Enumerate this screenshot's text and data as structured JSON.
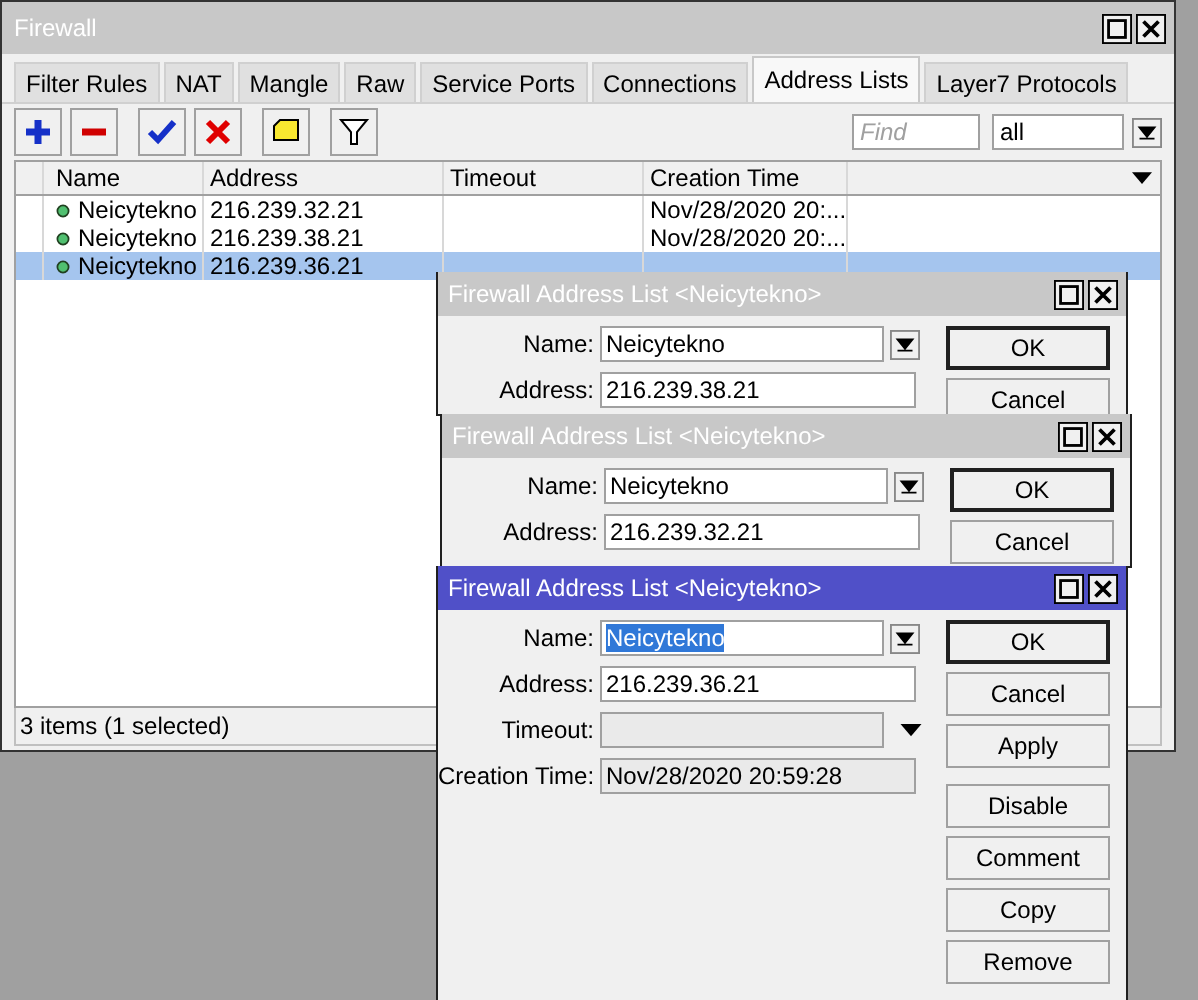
{
  "window": {
    "title": "Firewall"
  },
  "tabs": [
    {
      "label": "Filter Rules",
      "selected": false
    },
    {
      "label": "NAT",
      "selected": false
    },
    {
      "label": "Mangle",
      "selected": false
    },
    {
      "label": "Raw",
      "selected": false
    },
    {
      "label": "Service Ports",
      "selected": false
    },
    {
      "label": "Connections",
      "selected": false
    },
    {
      "label": "Address Lists",
      "selected": true
    },
    {
      "label": "Layer7 Protocols",
      "selected": false
    }
  ],
  "toolbar": {
    "find_placeholder": "Find",
    "filter_value": "all"
  },
  "table": {
    "columns": [
      "Name",
      "Address",
      "Timeout",
      "Creation Time"
    ],
    "rows": [
      {
        "name": "Neicytekno",
        "address": "216.239.32.21",
        "creation_time": "Nov/28/2020 20:...",
        "selected": false
      },
      {
        "name": "Neicytekno",
        "address": "216.239.38.21",
        "creation_time": "Nov/28/2020 20:...",
        "selected": false
      },
      {
        "name": "Neicytekno",
        "address": "216.239.36.21",
        "selected": true
      }
    ]
  },
  "status_bar": "3 items (1 selected)",
  "dialogs": [
    {
      "title": "Firewall Address List <Neicytekno>",
      "active": false,
      "name_selected": false,
      "fields": [
        {
          "label": "Name:",
          "value": "Neicytekno",
          "kind": "dropdown"
        },
        {
          "label": "Address:",
          "value": "216.239.38.21",
          "kind": "text"
        }
      ],
      "buttons": [
        [
          "OK",
          "Cancel"
        ]
      ]
    },
    {
      "title": "Firewall Address List <Neicytekno>",
      "active": false,
      "name_selected": false,
      "fields": [
        {
          "label": "Name:",
          "value": "Neicytekno",
          "kind": "dropdown"
        },
        {
          "label": "Address:",
          "value": "216.239.32.21",
          "kind": "text"
        }
      ],
      "buttons": [
        [
          "OK",
          "Cancel"
        ]
      ]
    },
    {
      "title": "Firewall Address List <Neicytekno>",
      "active": true,
      "name_selected": true,
      "fields": [
        {
          "label": "Name:",
          "value": "Neicytekno",
          "kind": "dropdown"
        },
        {
          "label": "Address:",
          "value": "216.239.36.21",
          "kind": "text"
        },
        {
          "label": "Timeout:",
          "kind": "disabled-dropdown"
        },
        {
          "label": "Creation Time:",
          "value": "Nov/28/2020 20:59:28",
          "kind": "readonly"
        }
      ],
      "buttons": [
        [
          "OK",
          "Cancel",
          "Apply"
        ],
        [
          "Disable",
          "Comment",
          "Copy",
          "Remove"
        ]
      ]
    }
  ]
}
